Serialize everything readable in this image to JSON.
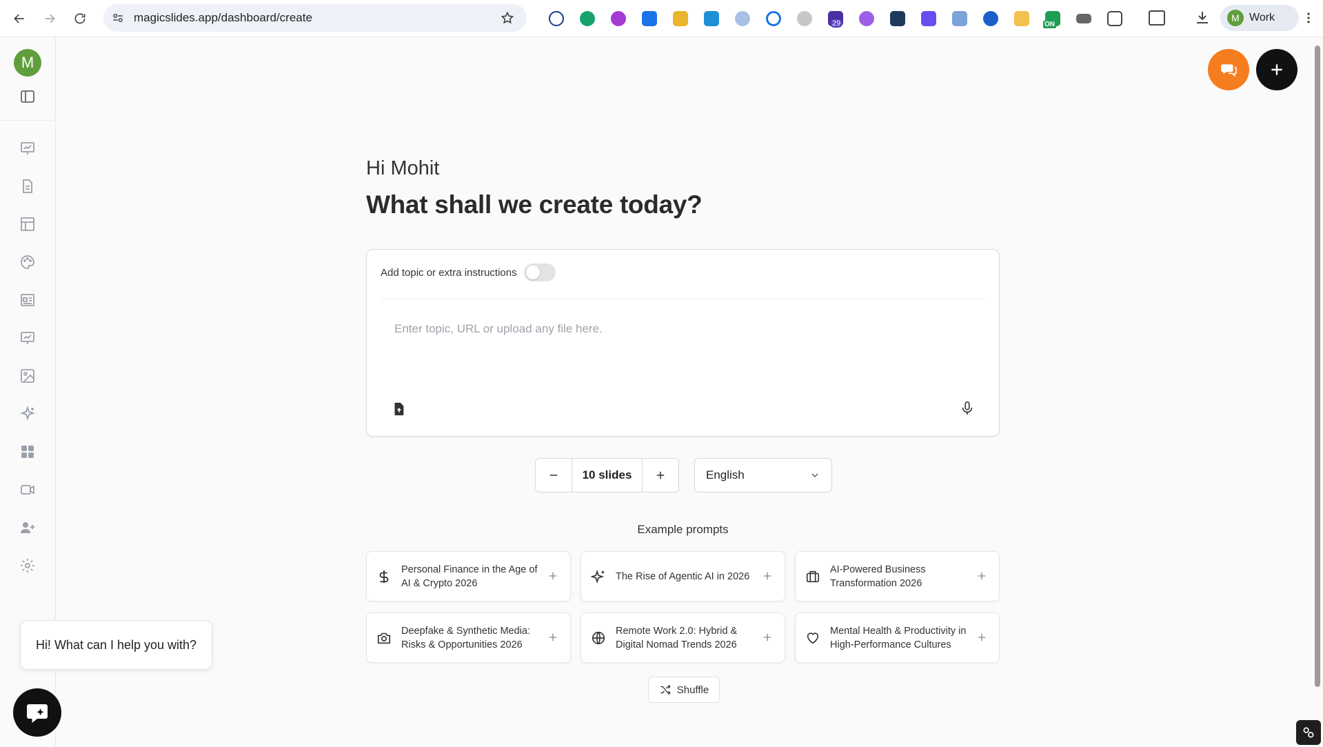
{
  "browser": {
    "url": "magicslides.app/dashboard/create",
    "profile_initial": "M",
    "profile_label": "Work",
    "extension_badge": "29",
    "extension_on_badge": "ON"
  },
  "sidebar": {
    "avatar_initial": "M"
  },
  "main": {
    "greeting": "Hi Mohit",
    "headline": "What shall we create today?",
    "toggle_label": "Add topic or extra instructions",
    "input_placeholder": "Enter topic, URL or upload any file here.",
    "slides_value": "10 slides",
    "language": "English",
    "examples_title": "Example prompts",
    "examples": [
      {
        "icon": "dollar-icon",
        "text": "Personal Finance in the Age of AI & Crypto 2026"
      },
      {
        "icon": "sparkles-icon",
        "text": "The Rise of Agentic AI in 2026"
      },
      {
        "icon": "briefcase-icon",
        "text": "AI-Powered Business Transformation 2026"
      },
      {
        "icon": "camera-icon",
        "text": "Deepfake & Synthetic Media: Risks & Opportunities 2026"
      },
      {
        "icon": "globe-icon",
        "text": "Remote Work 2.0: Hybrid & Digital Nomad Trends 2026"
      },
      {
        "icon": "heart-icon",
        "text": "Mental Health & Productivity in High-Performance Cultures"
      }
    ],
    "shuffle_label": "Shuffle"
  },
  "chat": {
    "bubble_text": "Hi! What can I help you with?"
  },
  "colors": {
    "accent_orange": "#f57c1f",
    "avatar_green": "#5f9e3a",
    "fab_black": "#111111"
  }
}
